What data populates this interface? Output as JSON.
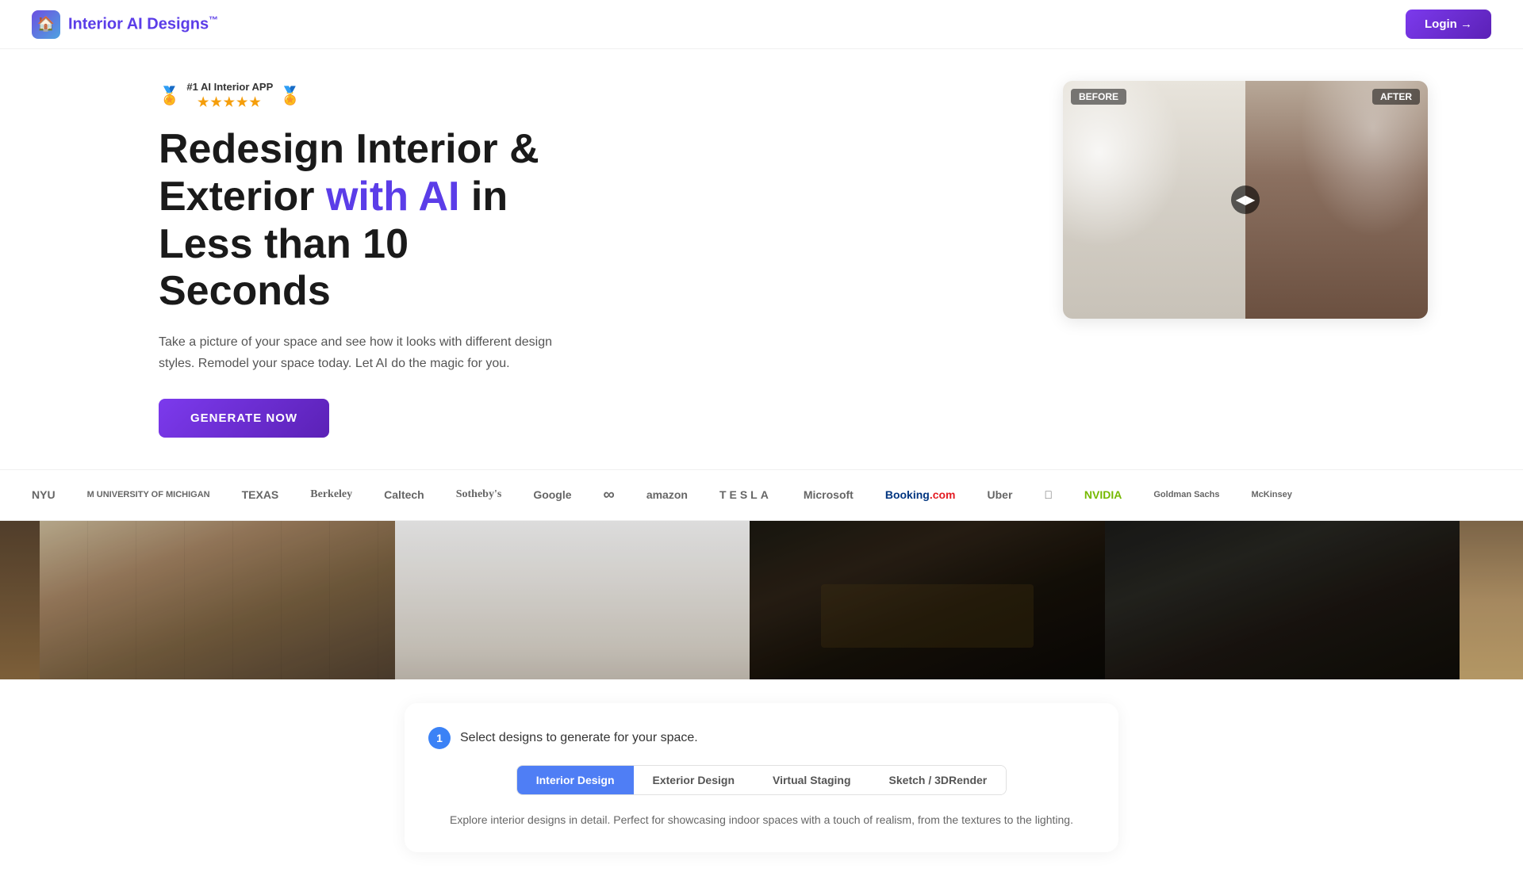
{
  "nav": {
    "logo_text": "Interior AI Designs",
    "logo_tm": "™",
    "login_label": "Login →"
  },
  "hero": {
    "award_badge": "#1 AI Interior APP",
    "stars": "★★★★★",
    "title_line1": "Redesign Interior &",
    "title_line2_normal": "Exterior ",
    "title_line2_highlight": "with AI",
    "title_line2_end": " in",
    "title_line3": "Less than 10 Seconds",
    "description": "Take a picture of your space and see how it looks with different design styles. Remodel your space today. Let AI do the magic for you.",
    "generate_btn": "GENERATE NOW",
    "before_label": "BEFORE",
    "after_label": "AFTER"
  },
  "logos": [
    {
      "text": "NYU",
      "style": ""
    },
    {
      "text": "M UNIVERSITY OF MICHIGAN",
      "style": "small"
    },
    {
      "text": "TEXAS",
      "style": ""
    },
    {
      "text": "Berkeley",
      "style": "serif"
    },
    {
      "text": "Caltech",
      "style": ""
    },
    {
      "text": "Sotheby's",
      "style": "serif"
    },
    {
      "text": "Google",
      "style": ""
    },
    {
      "text": "𝕄",
      "style": ""
    },
    {
      "text": "amazon",
      "style": ""
    },
    {
      "text": "TESLA",
      "style": ""
    },
    {
      "text": "Microsoft",
      "style": ""
    },
    {
      "text": "Booking.com",
      "style": ""
    },
    {
      "text": "Uber",
      "style": ""
    },
    {
      "text": "",
      "style": "apple"
    },
    {
      "text": "NVIDIA",
      "style": ""
    },
    {
      "text": "Goldman Sachs",
      "style": "small"
    },
    {
      "text": "McKinsey",
      "style": "small"
    }
  ],
  "design_selector": {
    "step_number": "1",
    "step_title": "Select designs to generate for your space.",
    "tabs": [
      {
        "label": "Interior Design",
        "active": true
      },
      {
        "label": "Exterior Design",
        "active": false
      },
      {
        "label": "Virtual Staging",
        "active": false
      },
      {
        "label": "Sketch / 3DRender",
        "active": false
      }
    ],
    "description": "Explore interior designs in detail. Perfect for showcasing indoor spaces with a touch of realism, from the textures to the lighting."
  },
  "colors": {
    "primary_purple": "#7c3aed",
    "primary_blue": "#5b3de8",
    "tab_blue": "#4f7ef5"
  }
}
